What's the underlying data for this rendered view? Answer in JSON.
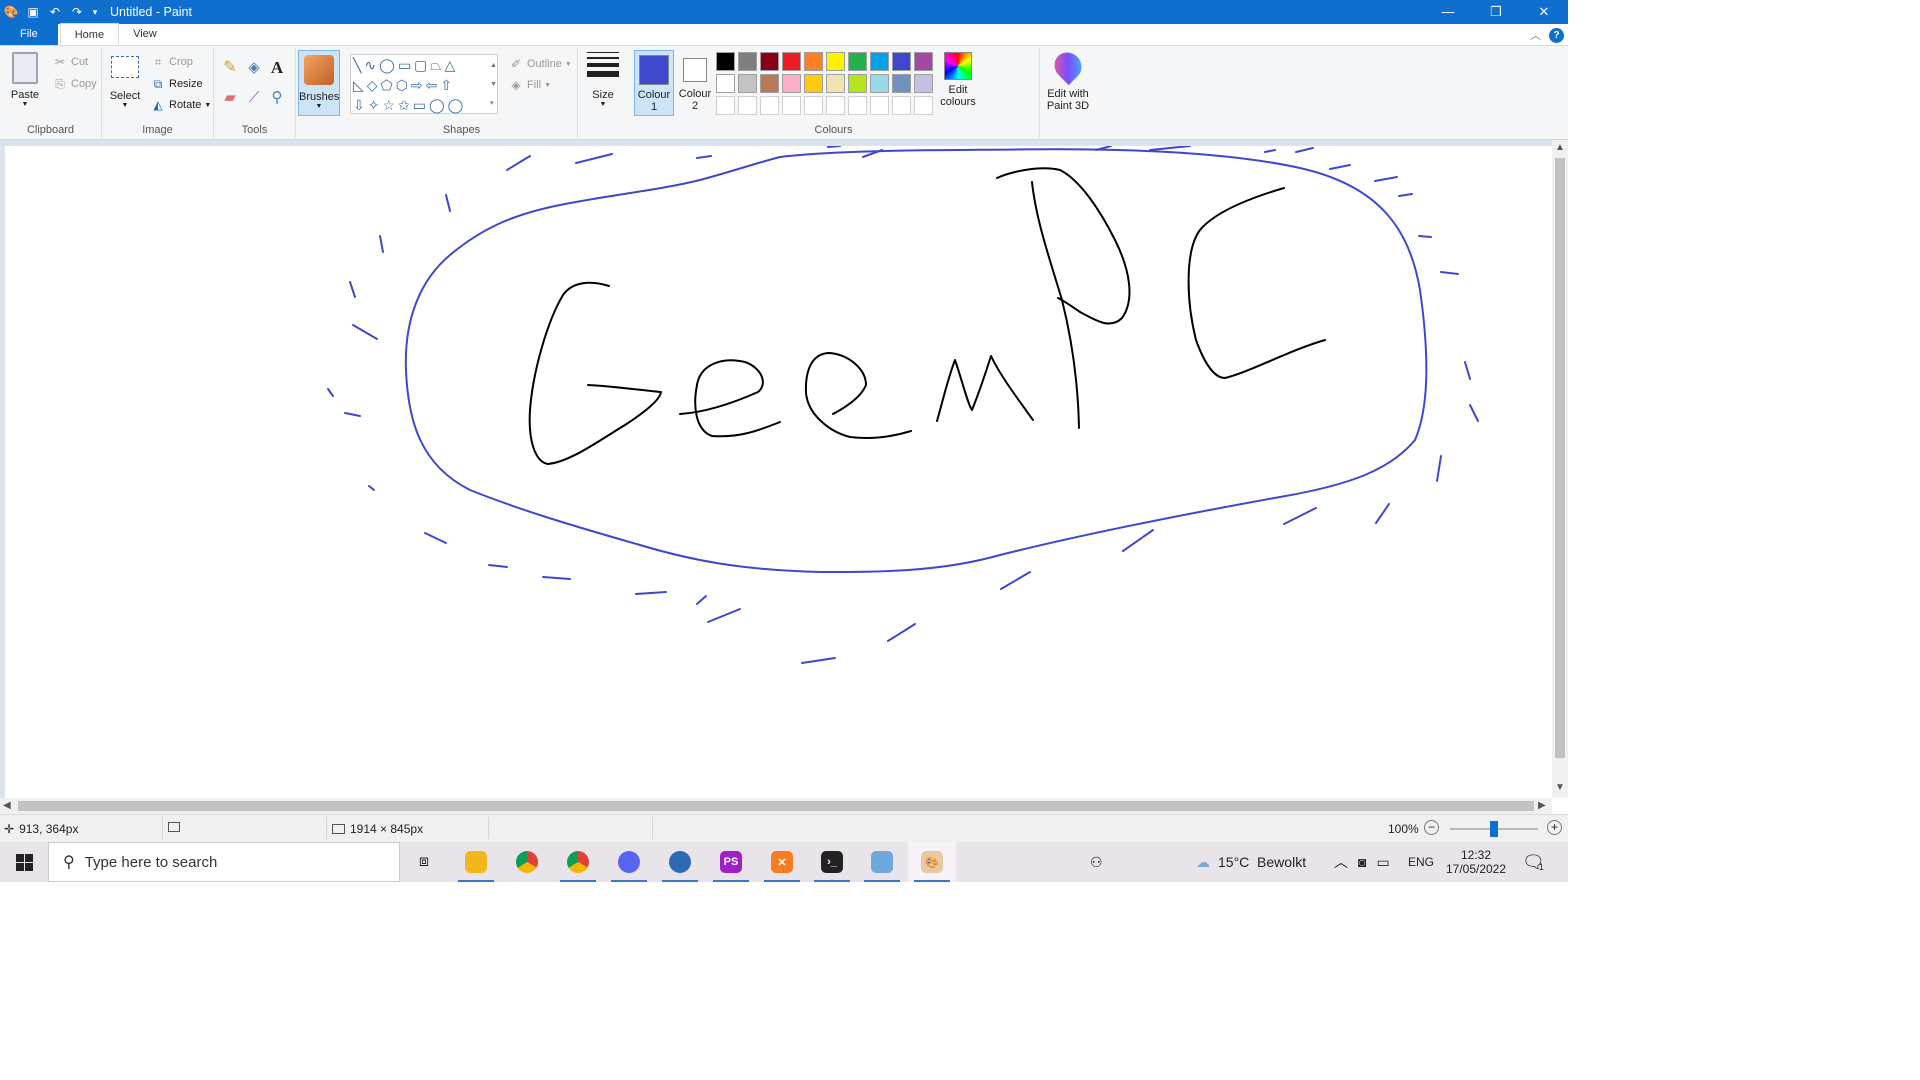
{
  "window": {
    "title": "Untitled - Paint",
    "controls": [
      "minimize-icon",
      "restore-icon",
      "close-icon"
    ]
  },
  "tabs": [
    {
      "label": "File"
    },
    {
      "label": "Home"
    },
    {
      "label": "View"
    }
  ],
  "ribbon": {
    "clipboard": {
      "label": "Clipboard",
      "paste": "Paste",
      "cut": "Cut",
      "copy": "Copy"
    },
    "image": {
      "label": "Image",
      "select": "Select",
      "crop": "Crop",
      "resize": "Resize",
      "rotate": "Rotate"
    },
    "tools": {
      "label": "Tools"
    },
    "brushes": {
      "label": "Brushes"
    },
    "shapes": {
      "label": "Shapes",
      "outline": "Outline",
      "fill": "Fill"
    },
    "size": {
      "label": "Size"
    },
    "colours": {
      "label": "Colours",
      "colour1": {
        "label": "Colour",
        "num": "1",
        "value": "#3f48cc"
      },
      "colour2": {
        "label": "Colour",
        "num": "2",
        "value": "#ffffff"
      },
      "edit_colours": "Edit colours",
      "palette_row1": [
        "#000000",
        "#7f7f7f",
        "#880015",
        "#ed1c24",
        "#ff7f27",
        "#fff200",
        "#22b14c",
        "#00a2e8",
        "#3f48cc",
        "#a349a4"
      ],
      "palette_row2": [
        "#ffffff",
        "#c3c3c3",
        "#b97a57",
        "#ffaec9",
        "#ffc90e",
        "#efe4b0",
        "#b5e61d",
        "#99d9ea",
        "#7092be",
        "#c8bfe7"
      ]
    },
    "paint3d": "Edit with Paint 3D"
  },
  "status": {
    "cursor": "913, 364px",
    "canvas_size": "1914 × 845px",
    "zoom": "100%"
  },
  "taskbar": {
    "search_placeholder": "Type here to search",
    "apps": [
      "task-view-icon",
      "file-explorer-icon",
      "chrome-icon",
      "chrome-profile-icon",
      "discord-icon",
      "app-icon",
      "phpstorm-icon",
      "xampp-icon",
      "terminal-icon",
      "notepad-icon",
      "paint-icon"
    ],
    "weather": "15°C  Bewolkt",
    "language": "ENG",
    "time": "12:32",
    "date": "17/05/2022",
    "notifications": "1"
  },
  "drawing": {
    "text": "GeenPC",
    "stroke_color": "#3f48cc",
    "ink_color": "#000000"
  }
}
